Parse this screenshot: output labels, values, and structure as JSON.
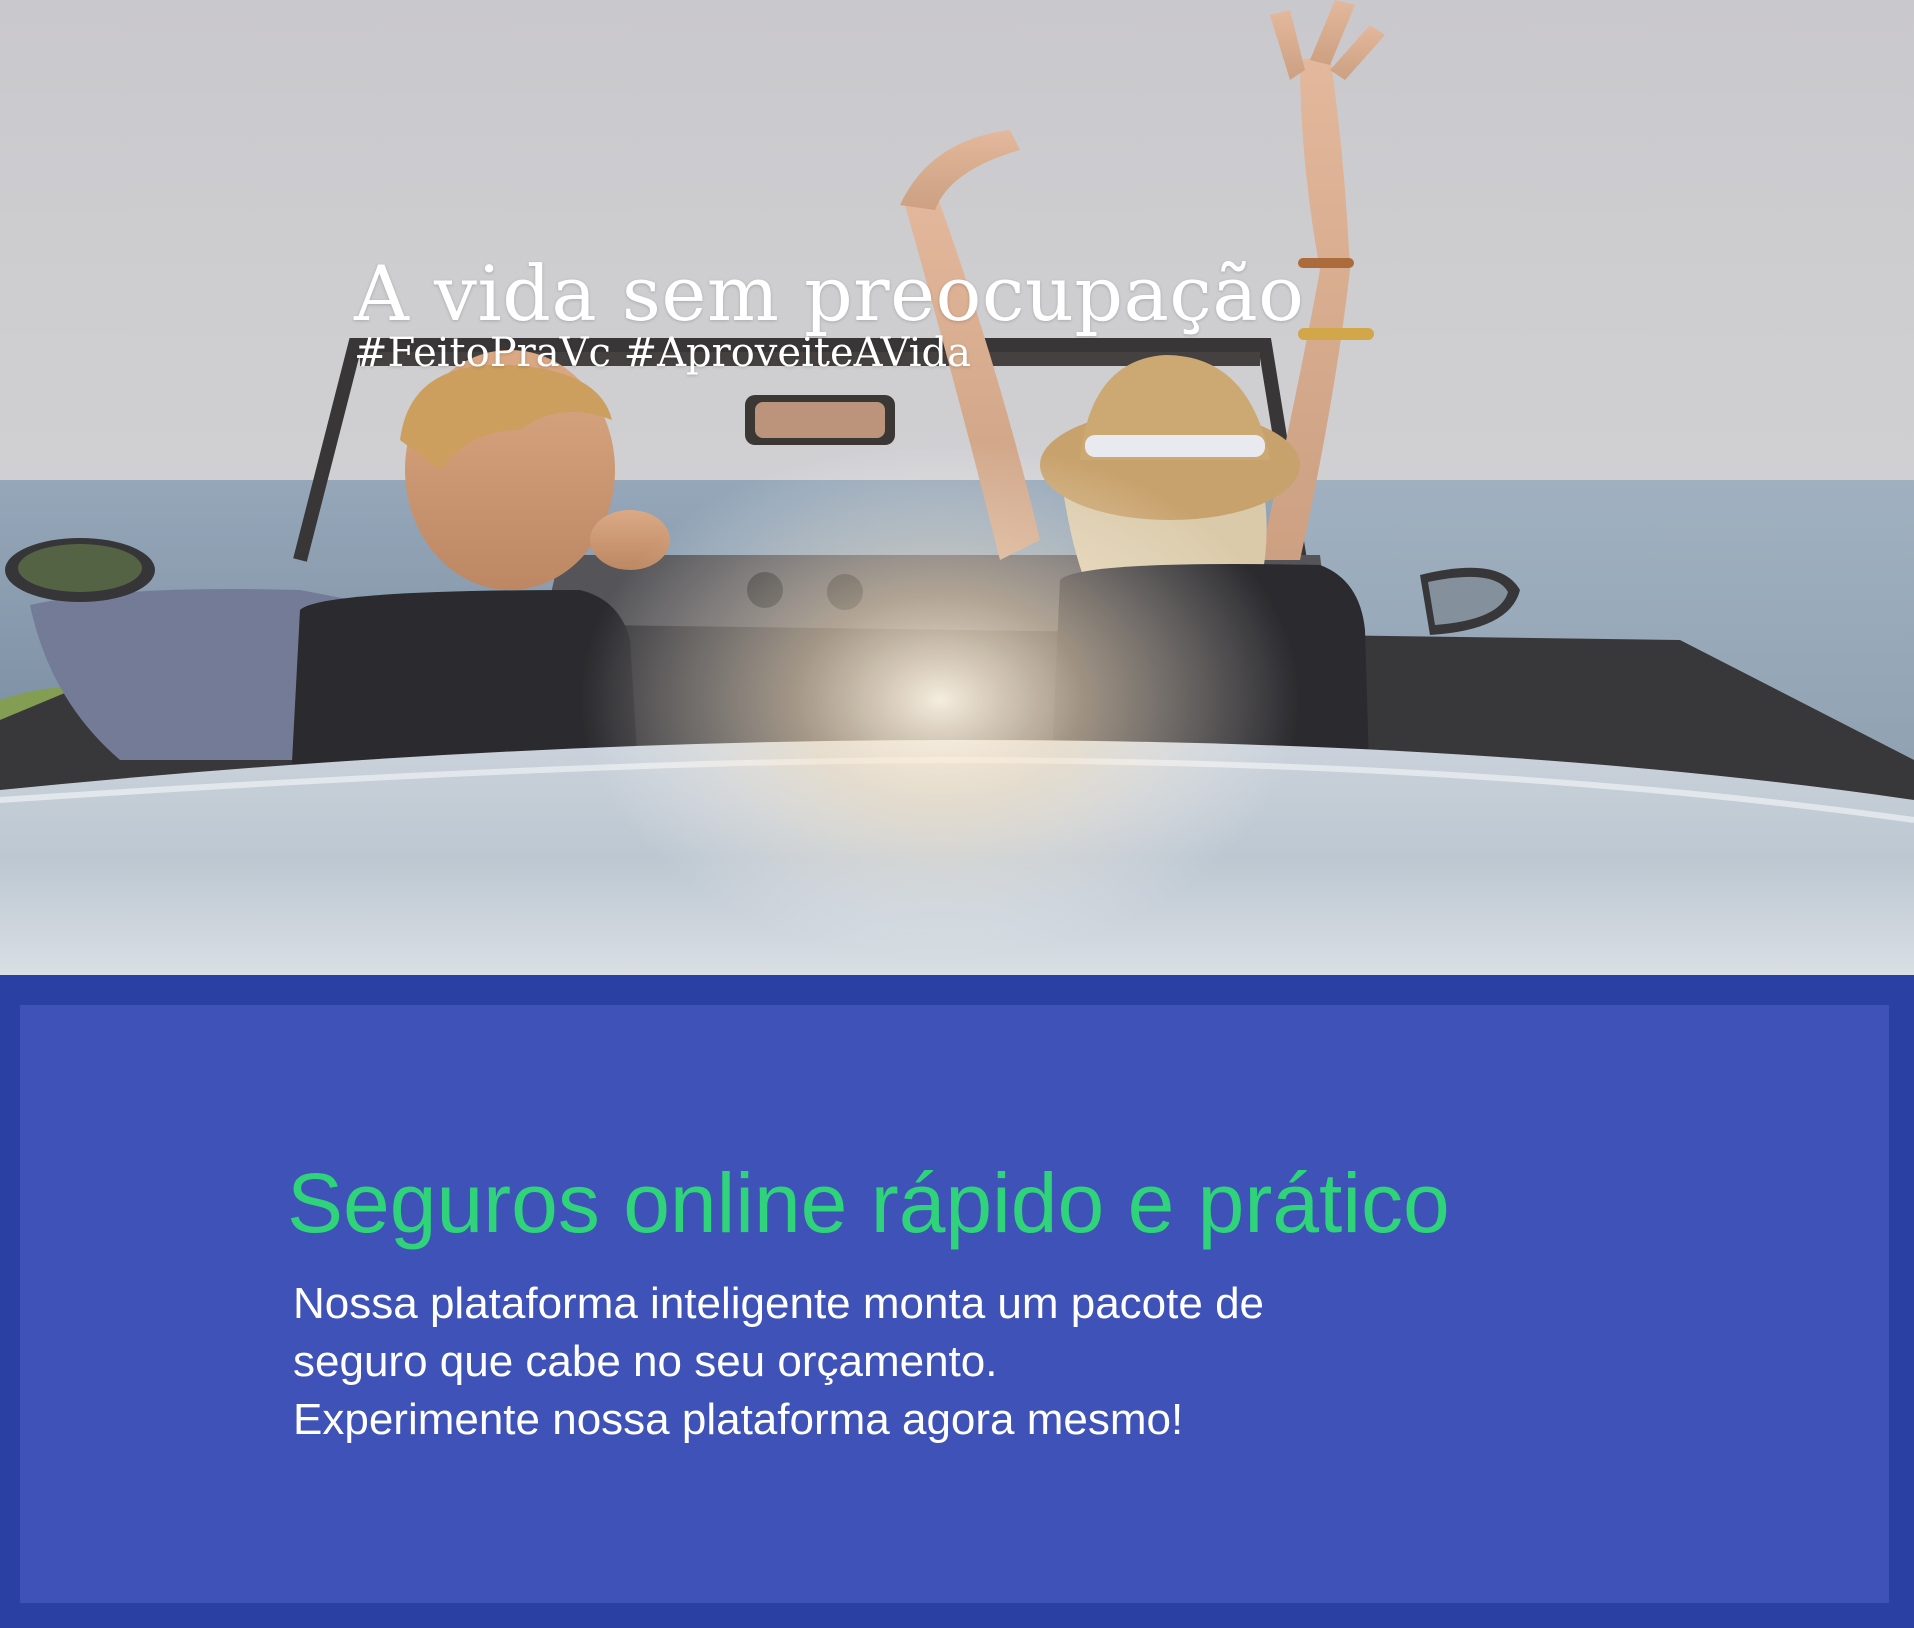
{
  "hero": {
    "title": "A vida sem preocupação",
    "hashtags": "#FeitoPraVc #AproveiteAVida",
    "image_subject": "couple-in-convertible-car-by-the-sea"
  },
  "info": {
    "heading": "Seguros online rápido e prático",
    "body_lines": [
      "Nossa plataforma inteligente monta um pacote de",
      "seguro que cabe no seu orçamento.",
      "Experimente nossa plataforma agora mesmo!"
    ]
  },
  "colors": {
    "panel_outer": "#2a40a3",
    "panel_inner": "#3e52b8",
    "heading_green": "#2fd37a",
    "text_white": "#ffffff"
  }
}
